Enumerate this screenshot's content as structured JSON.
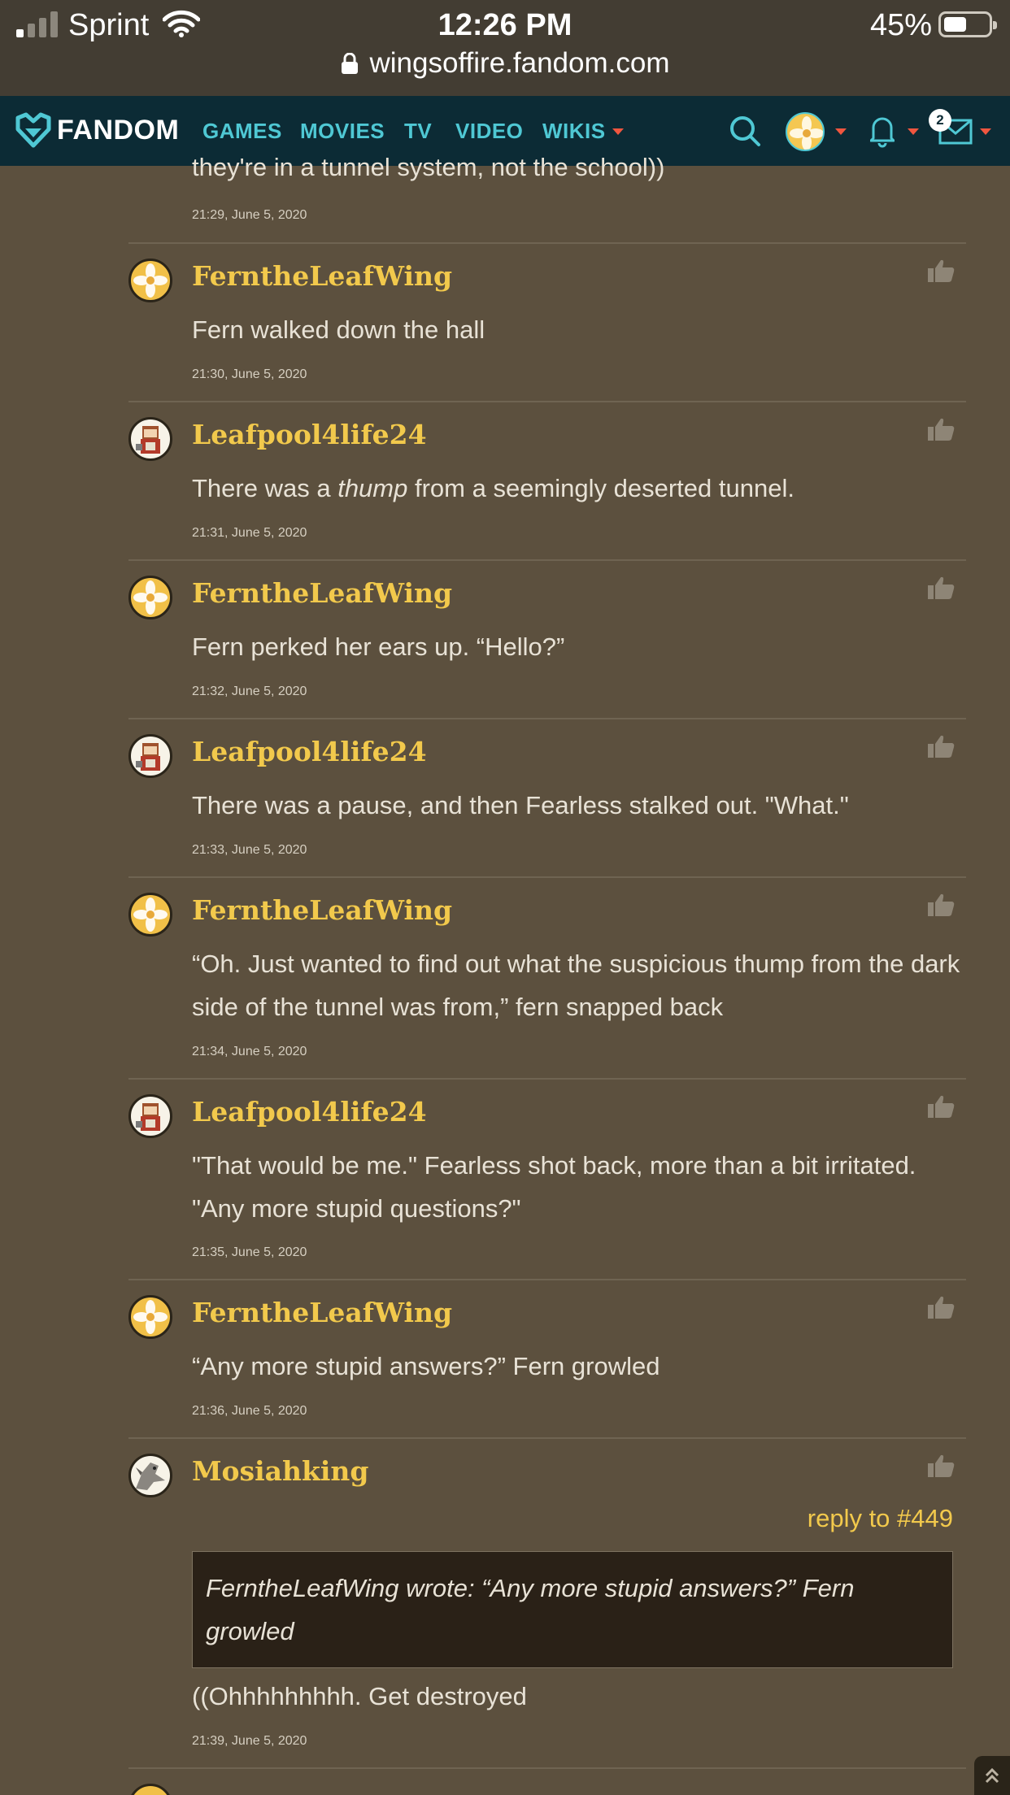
{
  "status_bar": {
    "carrier": "Sprint",
    "time": "12:26 PM",
    "battery_percent": "45%",
    "battery_level": 0.45,
    "url": "wingsoffire.fandom.com"
  },
  "navbar": {
    "logo_text": "FANDOM",
    "links": [
      "GAMES",
      "MOVIES",
      "TV",
      "VIDEO",
      "WIKIS"
    ],
    "message_count": "2",
    "accent_color": "#4fc8d4",
    "background_color": "#0c2b35"
  },
  "clipped_post": {
    "text": "they're in a tunnel system, not the school))",
    "timestamp": "21:29, June 5, 2020"
  },
  "posts": [
    {
      "username": "FerntheLeafWing",
      "avatar": "flower-avatar",
      "text": "Fern walked down the hall",
      "timestamp": "21:30, June 5, 2020"
    },
    {
      "username": "Leafpool4life24",
      "avatar": "character-avatar",
      "text_before": "There was a ",
      "text_italic": "thump",
      "text_after": " from a seemingly deserted tunnel.",
      "timestamp": "21:31, June 5, 2020"
    },
    {
      "username": "FerntheLeafWing",
      "avatar": "flower-avatar",
      "text": "Fern perked her ears up. “Hello?”",
      "timestamp": "21:32, June 5, 2020"
    },
    {
      "username": "Leafpool4life24",
      "avatar": "character-avatar",
      "text": "There was a pause, and then Fearless stalked out. \"What.\"",
      "timestamp": "21:33, June 5, 2020"
    },
    {
      "username": "FerntheLeafWing",
      "avatar": "flower-avatar",
      "text": "“Oh. Just wanted to find out what the suspicious thump from the dark side of the tunnel was from,” fern snapped back",
      "timestamp": "21:34, June 5, 2020"
    },
    {
      "username": "Leafpool4life24",
      "avatar": "character-avatar",
      "text": "\"That would be me.\" Fearless shot back, more than a bit irritated. \"Any more stupid questions?\"",
      "timestamp": "21:35, June 5, 2020"
    },
    {
      "username": "FerntheLeafWing",
      "avatar": "flower-avatar",
      "text": "“Any more stupid answers?” Fern growled",
      "timestamp": "21:36, June 5, 2020"
    },
    {
      "username": "Mosiahking",
      "avatar": "dragon-avatar",
      "reply_to": "reply to #449",
      "quote": "FerntheLeafWing wrote: “Any more stupid answers?” Fern growled",
      "text": "((Ohhhhhhhhh. Get destroyed",
      "timestamp": "21:39, June 5, 2020"
    }
  ],
  "colors": {
    "page_background": "#5c503e",
    "username": "#f2c94c",
    "quote_background": "#2a2117"
  }
}
